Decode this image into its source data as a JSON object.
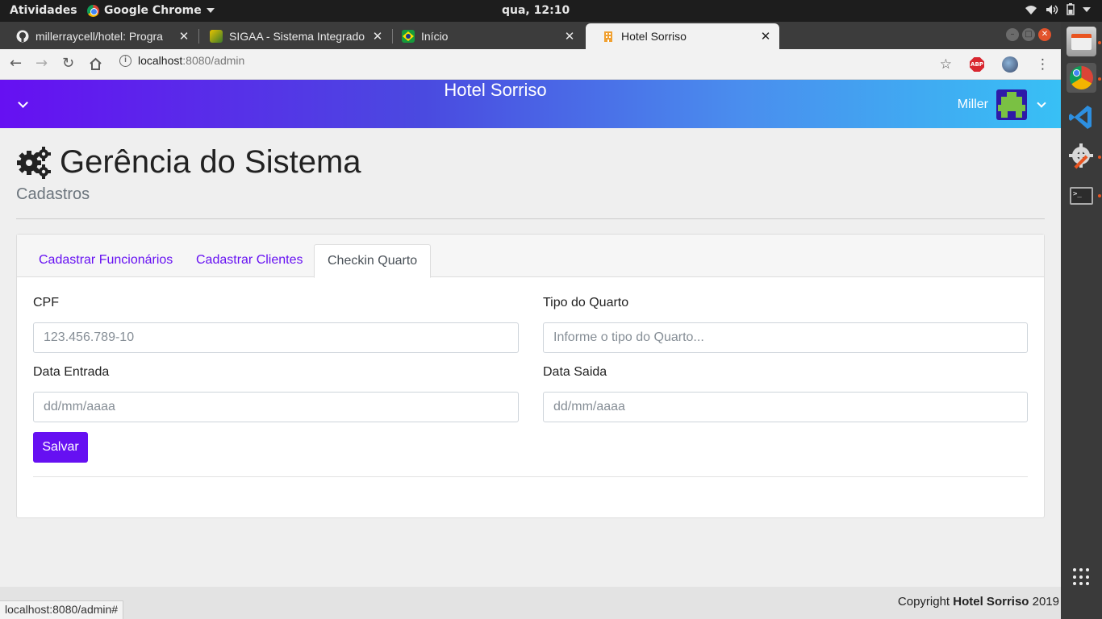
{
  "system": {
    "activities": "Atividades",
    "app_name": "Google Chrome",
    "clock": "qua, 12:10"
  },
  "browser": {
    "tabs": [
      {
        "title": "millerraycell/hotel: Progra",
        "icon": "github-icon"
      },
      {
        "title": "SIGAA - Sistema Integrado",
        "icon": "sigaa-icon"
      },
      {
        "title": "Início",
        "icon": "brazil-flag-icon"
      },
      {
        "title": "Hotel Sorriso",
        "icon": "hotel-icon",
        "active": true
      }
    ],
    "url_host": "localhost",
    "url_path": ":8080/admin",
    "status_url": "localhost:8080/admin#"
  },
  "navbar": {
    "brand": "Hotel Sorriso",
    "user_name": "Miller"
  },
  "page": {
    "title": "Gerência do Sistema",
    "subtitle": "Cadastros"
  },
  "tabs": [
    {
      "label": "Cadastrar Funcionários"
    },
    {
      "label": "Cadastrar Clientes"
    },
    {
      "label": "Checkin Quarto",
      "active": true
    }
  ],
  "form": {
    "cpf_label": "CPF",
    "cpf_placeholder": "123.456.789-10",
    "tipo_label": "Tipo do Quarto",
    "tipo_placeholder": "Informe o tipo do Quarto...",
    "entrada_label": "Data Entrada",
    "entrada_placeholder": "dd/mm/aaaa",
    "saida_label": "Data Saida",
    "saida_placeholder": "dd/mm/aaaa",
    "save_label": "Salvar"
  },
  "footer": {
    "prefix": "Copyright ",
    "brand": "Hotel Sorriso",
    "year": " 2019"
  },
  "colors": {
    "primary": "#6610f2",
    "nav_gradient_start": "#6610f2",
    "nav_gradient_end": "#38c0f5"
  }
}
